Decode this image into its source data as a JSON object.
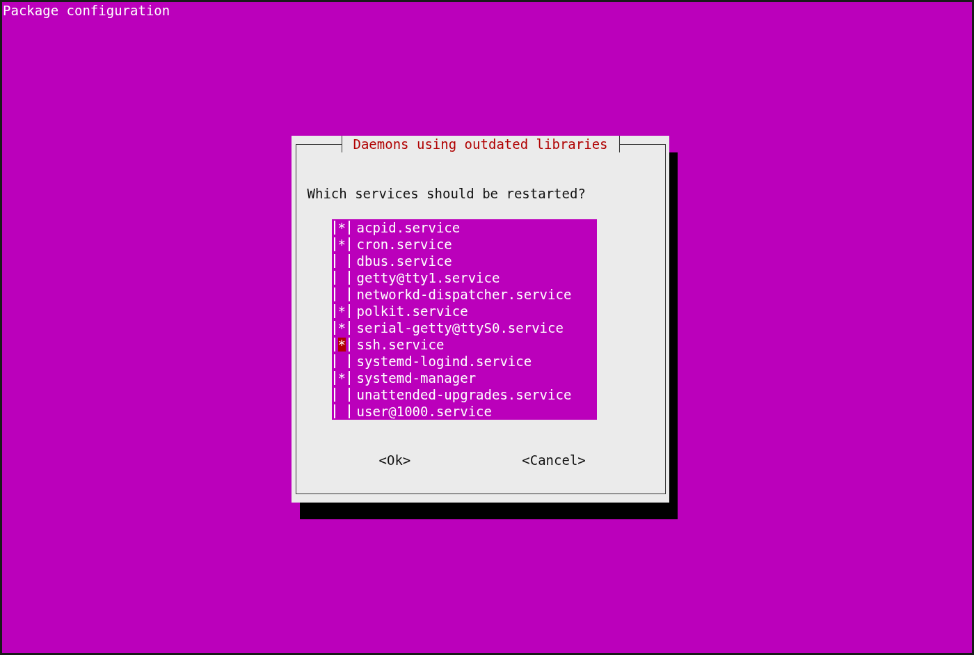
{
  "screen_title": "Package configuration",
  "dialog": {
    "title": "Daemons using outdated libraries",
    "question": "Which services should be restarted?",
    "checkbox_mark": "*",
    "items": [
      {
        "label": "acpid.service",
        "checked": true,
        "selected": false
      },
      {
        "label": "cron.service",
        "checked": true,
        "selected": false
      },
      {
        "label": "dbus.service",
        "checked": false,
        "selected": false
      },
      {
        "label": "getty@tty1.service",
        "checked": false,
        "selected": false
      },
      {
        "label": "networkd-dispatcher.service",
        "checked": false,
        "selected": false
      },
      {
        "label": "polkit.service",
        "checked": true,
        "selected": false
      },
      {
        "label": "serial-getty@ttyS0.service",
        "checked": true,
        "selected": false
      },
      {
        "label": "ssh.service",
        "checked": true,
        "selected": true
      },
      {
        "label": "systemd-logind.service",
        "checked": false,
        "selected": false
      },
      {
        "label": "systemd-manager",
        "checked": true,
        "selected": false
      },
      {
        "label": "unattended-upgrades.service",
        "checked": false,
        "selected": false
      },
      {
        "label": "user@1000.service",
        "checked": false,
        "selected": false
      }
    ],
    "buttons": [
      "<Ok>",
      "<Cancel>"
    ]
  }
}
